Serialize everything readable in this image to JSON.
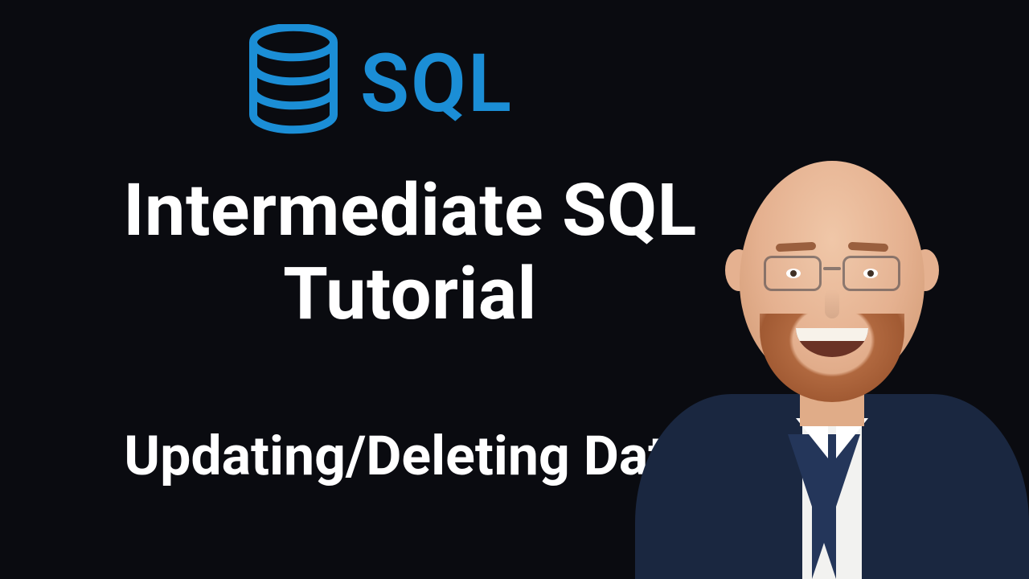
{
  "logo": {
    "label": "SQL",
    "icon_name": "database-icon",
    "color": "#1b8ed6"
  },
  "title": {
    "line1": "Intermediate SQL",
    "line2": "Tutorial"
  },
  "subtitle": "Updating/Deleting Data"
}
